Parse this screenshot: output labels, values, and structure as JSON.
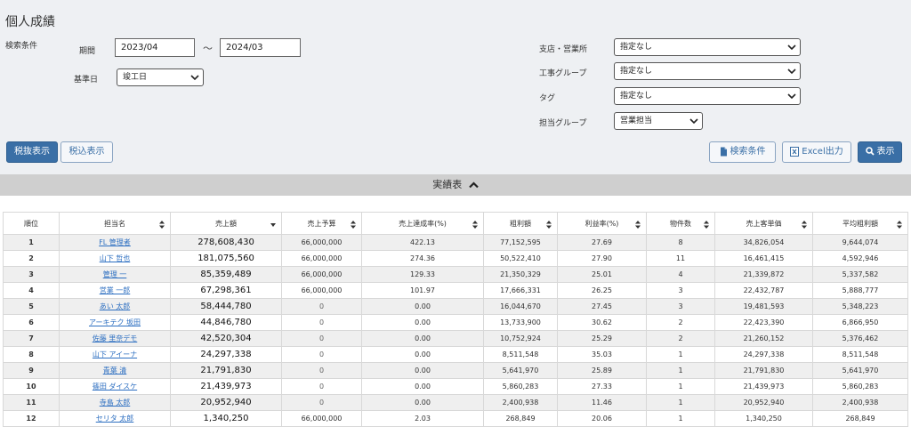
{
  "page": {
    "title": "個人成績"
  },
  "search": {
    "section_label": "検索条件",
    "period_label": "期間",
    "period_from": "2023/04",
    "period_sep": "～",
    "period_to": "2024/03",
    "base_date_label": "基準日",
    "base_date_value": "竣工日",
    "branch_label": "支店・営業所",
    "branch_value": "指定なし",
    "construction_group_label": "工事グループ",
    "construction_group_value": "指定なし",
    "tag_label": "タグ",
    "tag_value": "指定なし",
    "staff_group_label": "担当グループ",
    "staff_group_value": "営業担当"
  },
  "buttons": {
    "tax_excluded": "税抜表示",
    "tax_included": "税込表示",
    "search_conditions": "検索条件",
    "excel_export": "Excel出力",
    "display": "表示"
  },
  "colors": {
    "primary": "#3a6fa6",
    "link": "#2d6fc1",
    "section_bar": "#cfcfcf",
    "panel": "#eef0f3"
  },
  "section": {
    "title": "実績表"
  },
  "table": {
    "headers": [
      "順位",
      "担当名",
      "売上額",
      "売上予算",
      "売上達成率(%)",
      "粗利額",
      "利益率(%)",
      "物件数",
      "売上客単価",
      "平均粗利額"
    ],
    "rows": [
      [
        "1",
        "FL 管理者",
        "278,608,430",
        "66,000,000",
        "422.13",
        "77,152,595",
        "27.69",
        "8",
        "34,826,054",
        "9,644,074"
      ],
      [
        "2",
        "山下 哲也",
        "181,075,560",
        "66,000,000",
        "274.36",
        "50,522,410",
        "27.90",
        "11",
        "16,461,415",
        "4,592,946"
      ],
      [
        "3",
        "管理 一",
        "85,359,489",
        "66,000,000",
        "129.33",
        "21,350,329",
        "25.01",
        "4",
        "21,339,872",
        "5,337,582"
      ],
      [
        "4",
        "営業 一郎",
        "67,298,361",
        "66,000,000",
        "101.97",
        "17,666,331",
        "26.25",
        "3",
        "22,432,787",
        "5,888,777"
      ],
      [
        "5",
        "あい 太郎",
        "58,444,780",
        "0",
        "0.00",
        "16,044,670",
        "27.45",
        "3",
        "19,481,593",
        "5,348,223"
      ],
      [
        "6",
        "アーキテク 坂田",
        "44,846,780",
        "0",
        "0.00",
        "13,733,900",
        "30.62",
        "2",
        "22,423,390",
        "6,866,950"
      ],
      [
        "7",
        "佐藤 里奈デモ",
        "42,520,304",
        "0",
        "0.00",
        "10,752,924",
        "25.29",
        "2",
        "21,260,152",
        "5,376,462"
      ],
      [
        "8",
        "山下 アイーナ",
        "24,297,338",
        "0",
        "0.00",
        "8,511,548",
        "35.03",
        "1",
        "24,297,338",
        "8,511,548"
      ],
      [
        "9",
        "青葉 清",
        "21,791,830",
        "0",
        "0.00",
        "5,641,970",
        "25.89",
        "1",
        "21,791,830",
        "5,641,970"
      ],
      [
        "10",
        "篠田 ダイスケ",
        "21,439,973",
        "0",
        "0.00",
        "5,860,283",
        "27.33",
        "1",
        "21,439,973",
        "5,860,283"
      ],
      [
        "11",
        "寺島 太郎",
        "20,952,940",
        "0",
        "0.00",
        "2,400,938",
        "11.46",
        "1",
        "20,952,940",
        "2,400,938"
      ],
      [
        "12",
        "セリタ 太郎",
        "1,340,250",
        "66,000,000",
        "2.03",
        "268,849",
        "20.06",
        "1",
        "1,340,250",
        "268,849"
      ]
    ]
  }
}
